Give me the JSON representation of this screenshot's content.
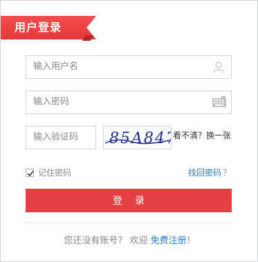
{
  "header": {
    "title": "用户登录"
  },
  "form": {
    "username_placeholder": "输入用户名",
    "password_placeholder": "输入密码",
    "captcha_placeholder": "输入验证码",
    "captcha_text": "85A847",
    "refresh_label": "看不清？换一张",
    "remember_label": "记住密码",
    "remember_checked": true,
    "forgot_label": "找回密码",
    "forgot_suffix": "？",
    "login_label": "登录"
  },
  "footer": {
    "prompt": "您还没有账号？ 欢迎",
    "register_link": "免费注册",
    "suffix": "！"
  },
  "colors": {
    "accent": "#e64044",
    "link": "#2a7dc8"
  },
  "icons": [
    "user-icon",
    "keyboard-icon",
    "check-icon"
  ]
}
